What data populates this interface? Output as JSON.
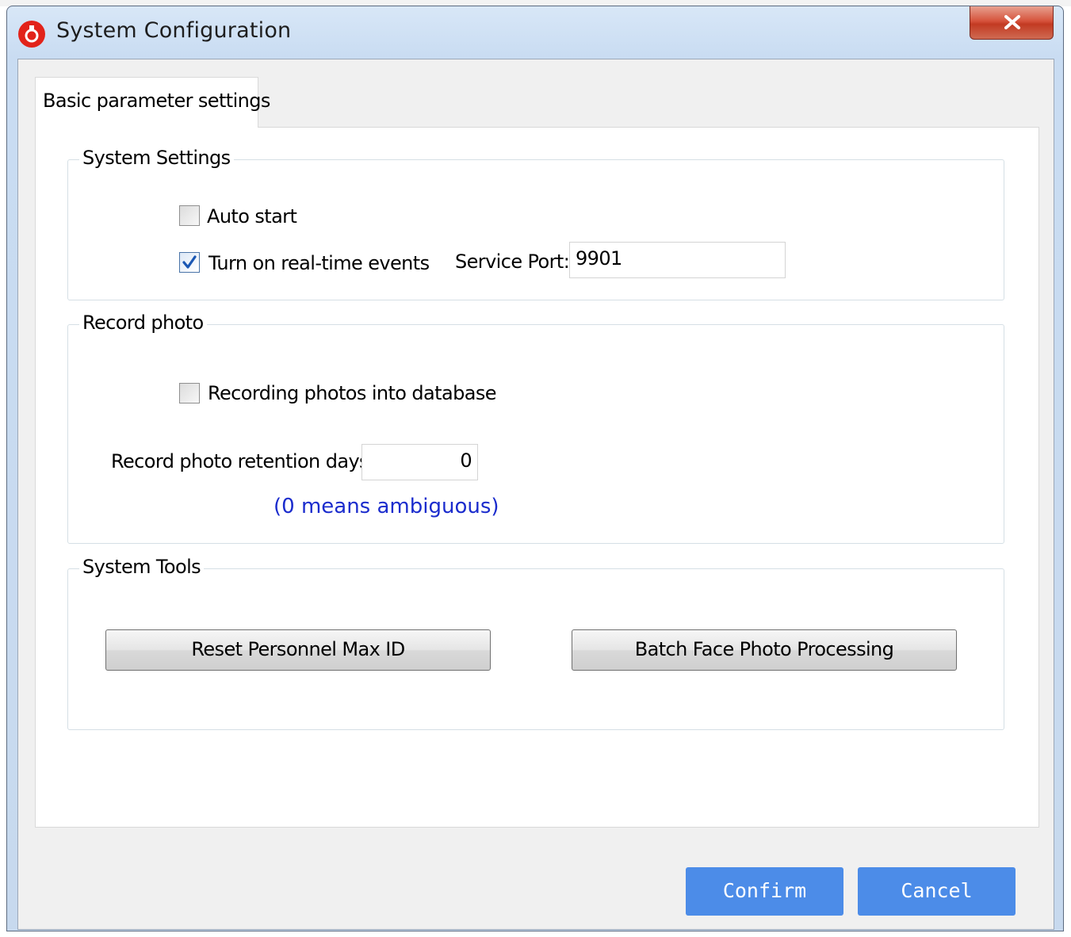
{
  "window": {
    "title": "System Configuration",
    "icon": "app-logo-icon",
    "close_icon": "close-icon"
  },
  "tabs": [
    {
      "label": "Basic parameter settings",
      "selected": true
    }
  ],
  "system_settings": {
    "title": "System Settings",
    "auto_start": {
      "label": "Auto start",
      "checked": false
    },
    "realtime_events": {
      "label": "Turn on real-time events",
      "checked": true
    },
    "service_port": {
      "label": "Service Port:",
      "value": "9901"
    }
  },
  "record_photo": {
    "title": "Record photo",
    "recording_into_db": {
      "label": "Recording photos into database",
      "checked": false
    },
    "retention_days": {
      "label": "Record photo retention days",
      "value": "0"
    },
    "note": "(0 means ambiguous)"
  },
  "system_tools": {
    "title": "System Tools",
    "reset_button": "Reset Personnel Max ID",
    "batch_button": "Batch Face Photo Processing"
  },
  "footer": {
    "confirm_label": "Confirm",
    "cancel_label": "Cancel"
  },
  "colors": {
    "accent_button": "#4c8ce8",
    "note_text": "#1b2ccd",
    "checkbox_check": "#1b57b3"
  }
}
